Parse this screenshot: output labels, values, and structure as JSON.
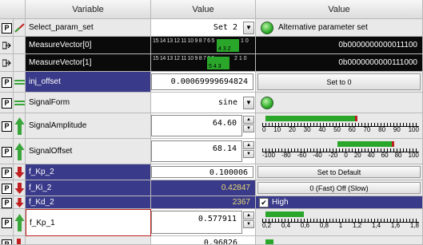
{
  "headers": {
    "variable": "Variable",
    "value": "Value",
    "value2": "Value"
  },
  "rows": {
    "select_param_set": {
      "name": "Select_param_set",
      "value": "Set 2",
      "status_label": "Alternative parameter set"
    },
    "measure0": {
      "name": "MeasureVector[0]",
      "bit_labels": "15 14 13 12 11 10 9  8  7  6  5",
      "bit_low": "1  0",
      "bit_low2": "4  3  2",
      "hex": "0b0000000000011100"
    },
    "measure1": {
      "name": "MeasureVector[1]",
      "bit_labels": "15 14 13 12 11 10 9  8  7  6  5",
      "bit_low": "2  1  0",
      "bit_low2": "5  4  3",
      "hex": "0b0000000000111000"
    },
    "inj_offset": {
      "name": "inj_offset",
      "value": "0.00069999694824",
      "button": "Set to 0"
    },
    "signal_form": {
      "name": "SignalForm",
      "value": "sine"
    },
    "signal_amplitude": {
      "name": "SignalAmplitude",
      "value": "64.60",
      "scale": [
        "0",
        "10",
        "20",
        "30",
        "40",
        "50",
        "60",
        "70",
        "80",
        "90",
        "100"
      ],
      "level": 64.6
    },
    "signal_offset": {
      "name": "SignalOffset",
      "value": "68.14",
      "scale": [
        "-100",
        "-80",
        "-60",
        "-40",
        "-20",
        "0",
        "20",
        "40",
        "60",
        "80",
        "100"
      ],
      "level": 68.14
    },
    "f_kp_2": {
      "name": "f_Kp_2",
      "value": "0.100006",
      "button": "Set to Default"
    },
    "f_ki_2": {
      "name": "f_Ki_2",
      "value": "0.42847",
      "button": "0 (Fast) Off (Slow)"
    },
    "f_kd_2": {
      "name": "f_Kd_2",
      "value": "2367",
      "check_label": "High"
    },
    "f_kp_1": {
      "name": "f_Kp_1",
      "value": "0.577911",
      "scale": [
        "0,2",
        "0,4",
        "0,6",
        "0,8",
        "1",
        "1,2",
        "1,4",
        "1,6",
        "1,8"
      ],
      "level": 0.577911
    },
    "last": {
      "value": "0.96826"
    }
  },
  "colors": {
    "dark_bg": "#0a0a0a",
    "blue_bg": "#3a3a8a",
    "led_green": "#2fae2a",
    "bar_green": "#2aa62a",
    "up_arrow": "#3aa53a",
    "down_arrow": "#c02020"
  }
}
